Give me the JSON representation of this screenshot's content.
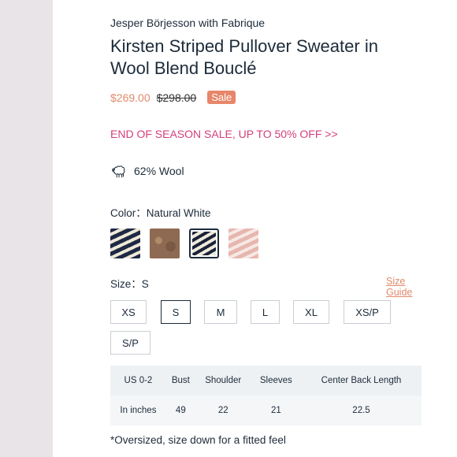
{
  "product": {
    "brand": "Jesper Börjesson with Fabrique",
    "title": "Kirsten Striped Pullover Sweater in Wool Blend Bouclé",
    "price_sale": "$269.00",
    "price_original": "$298.00",
    "badge": "Sale",
    "promo": "END OF SEASON SALE, UP TO 50% OFF >>",
    "wool": "62% Wool"
  },
  "color": {
    "label": "Color：",
    "value": "Natural White",
    "swatches": [
      {
        "name": "navy-cream-stripe",
        "selected": false
      },
      {
        "name": "brown-melange",
        "selected": false
      },
      {
        "name": "navy-natural-stripe",
        "selected": true
      },
      {
        "name": "pink-stripe",
        "selected": false
      }
    ]
  },
  "size": {
    "label": "Size：",
    "value": "S",
    "guide": "Size Guide",
    "options": [
      "XS",
      "S",
      "M",
      "L",
      "XL",
      "XS/P",
      "S/P"
    ]
  },
  "table": {
    "headers": [
      "US 0-2",
      "Bust",
      "Shoulder",
      "Sleeves",
      "Center Back Length"
    ],
    "row": [
      "In inches",
      "49",
      "22",
      "21",
      "22.5"
    ]
  },
  "note": "*Oversized, size down for a fitted feel",
  "colors": {
    "sale": "#e08a6a",
    "badge": "#e8866a",
    "promo": "#d43f7c",
    "text": "#1c2b3a"
  }
}
